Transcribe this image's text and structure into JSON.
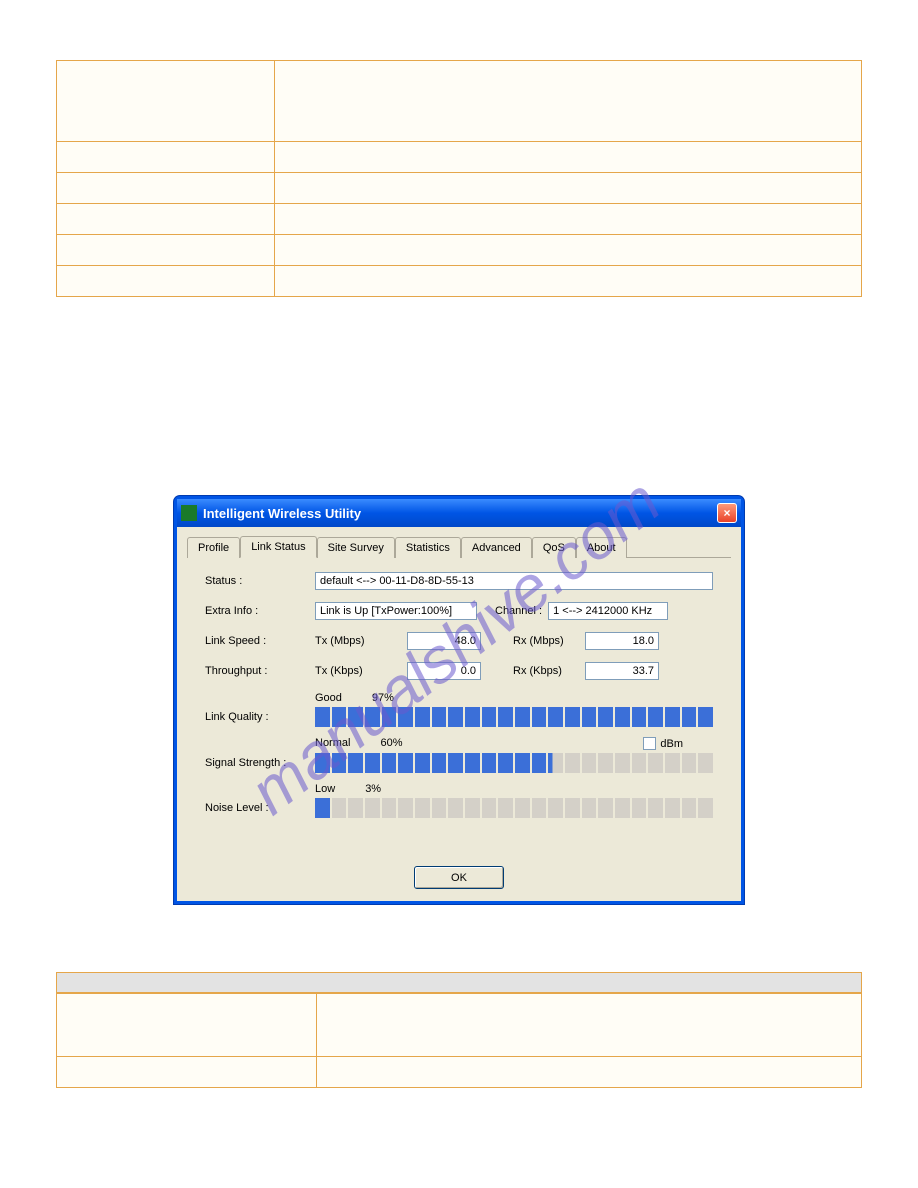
{
  "watermark_text": "manualshive.com",
  "window": {
    "title": "Intelligent Wireless Utility",
    "close_glyph": "×"
  },
  "tabs": [
    {
      "label": "Profile",
      "active": false
    },
    {
      "label": "Link Status",
      "active": true
    },
    {
      "label": "Site Survey",
      "active": false
    },
    {
      "label": "Statistics",
      "active": false
    },
    {
      "label": "Advanced",
      "active": false
    },
    {
      "label": "QoS",
      "active": false
    },
    {
      "label": "About",
      "active": false
    }
  ],
  "fields": {
    "status_label": "Status :",
    "status_value": "default <--> 00-11-D8-8D-55-13",
    "extra_label": "Extra Info :",
    "extra_value": "Link is Up [TxPower:100%]",
    "channel_label": "Channel :",
    "channel_value": "1 <--> 2412000 KHz",
    "linkspeed_label": "Link Speed :",
    "tx_mbps_label": "Tx (Mbps)",
    "tx_mbps_value": "48.0",
    "rx_mbps_label": "Rx (Mbps)",
    "rx_mbps_value": "18.0",
    "throughput_label": "Throughput :",
    "tx_kbps_label": "Tx (Kbps)",
    "tx_kbps_value": "0.0",
    "rx_kbps_label": "Rx (Kbps)",
    "rx_kbps_value": "33.7"
  },
  "bars": {
    "link_quality_label": "Link Quality :",
    "link_quality_rating": "Good",
    "link_quality_pct": "97%",
    "link_quality_segments_on": 24,
    "signal_label": "Signal Strength :",
    "signal_rating": "Normal",
    "signal_pct": "60%",
    "signal_segments_on": 14,
    "dbm_label": "dBm",
    "noise_label": "Noise Level :",
    "noise_rating": "Low",
    "noise_pct": "3%",
    "noise_segments_on": 1
  },
  "buttons": {
    "ok": "OK"
  }
}
